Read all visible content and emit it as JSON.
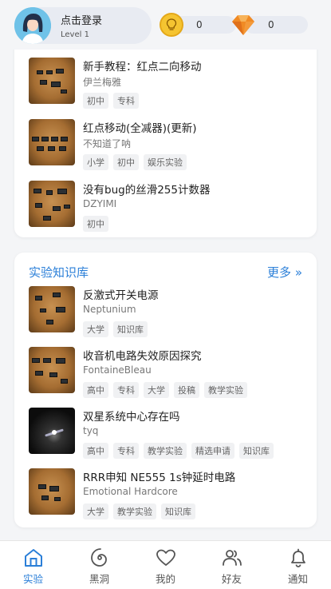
{
  "header": {
    "login_label": "点击登录",
    "level": "Level 1",
    "coins": "0",
    "gems": "0"
  },
  "top_list": [
    {
      "title": "新手教程：红点二向移动",
      "author": "伊兰梅雅",
      "tags": [
        "初中",
        "专科"
      ]
    },
    {
      "title": "红点移动(全减器)(更新)",
      "author": "不知道了呐",
      "tags": [
        "小学",
        "初中",
        "娱乐实验"
      ]
    },
    {
      "title": "没有bug的丝滑255计数器",
      "author": "DZYIMI",
      "tags": [
        "初中"
      ]
    }
  ],
  "knowledge": {
    "title": "实验知识库",
    "more": "更多 »",
    "items": [
      {
        "title": "反激式开关电源",
        "author": "Neptunium",
        "tags": [
          "大学",
          "知识库"
        ]
      },
      {
        "title": "收音机电路失效原因探究",
        "author": "FontaineBleau",
        "tags": [
          "高中",
          "专科",
          "大学",
          "投稿",
          "教学实验"
        ]
      },
      {
        "title": "双星系统中心存在吗",
        "author": "tyq",
        "tags": [
          "高中",
          "专科",
          "教学实验",
          "精选申请",
          "知识库"
        ]
      },
      {
        "title": "RRR申知  NE555 1s钟延时电路",
        "author": "Emotional Hardcore",
        "tags": [
          "大学",
          "教学实验",
          "知识库"
        ]
      }
    ]
  },
  "nav": [
    {
      "label": "实验",
      "icon": "home-icon",
      "active": true
    },
    {
      "label": "黑洞",
      "icon": "blackhole-icon"
    },
    {
      "label": "我的",
      "icon": "heart-icon"
    },
    {
      "label": "好友",
      "icon": "friends-icon"
    },
    {
      "label": "通知",
      "icon": "bell-icon"
    }
  ],
  "colors": {
    "accent": "#2b7fd8",
    "coin": "#f5c431",
    "gem": "#f08a24"
  }
}
